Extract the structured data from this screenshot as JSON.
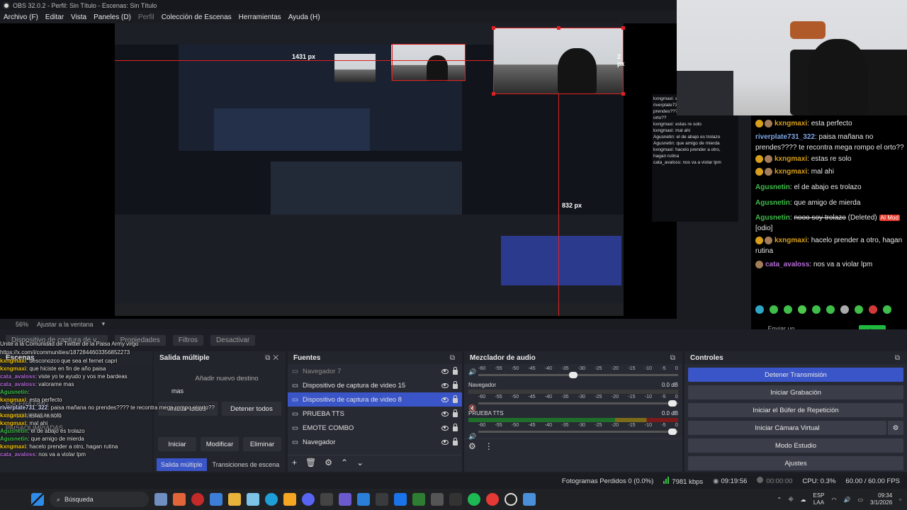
{
  "window": {
    "title": "OBS 32.0.2 - Perfil: Sin Título - Escenas: Sin Título"
  },
  "menu": [
    "Archivo (F)",
    "Editar",
    "Vista",
    "Paneles (D)",
    "Perfil",
    "Colección de Escenas",
    "Herramientas",
    "Ayuda (H)"
  ],
  "preview": {
    "px_label_1": "1431 px",
    "px_label_2": "2 px",
    "px_label_3": "832 px"
  },
  "zoom": {
    "value": "56%",
    "fit_label": "Ajustar a la ventana"
  },
  "source_toolbar": {
    "source_label": "Dispositivo de captura de v...",
    "properties": "Propiedades",
    "filters": "Filtros",
    "deactivate": "Desactivar"
  },
  "multi_output": {
    "title": "Salida múltiple",
    "add_destination": "Añadir nuevo destino",
    "name_hint": "mas",
    "start_all": "Iniciar todos",
    "stop_all": "Detener todos",
    "start": "Iniciar",
    "modify": "Modificar",
    "delete": "Eliminar",
    "tab_multi": "Salida múltiple",
    "tab_transitions": "Transiciones de escena"
  },
  "sources": {
    "title": "Fuentes",
    "items": [
      "Navegador 7",
      "Dispositivo de captura de video 15",
      "Dispositivo de captura de video 8",
      "PRUEBA TTS",
      "EMOTE COMBO",
      "Navegador"
    ]
  },
  "mixer": {
    "title": "Mezclador de audio",
    "scale": [
      "-60",
      "-55",
      "-50",
      "-45",
      "-40",
      "-35",
      "-30",
      "-25",
      "-20",
      "-15",
      "-10",
      "-5",
      "0"
    ],
    "channels": [
      {
        "name": "",
        "db": ""
      },
      {
        "name": "Navegador",
        "db": "0.0 dB"
      },
      {
        "name": "PRUEBA TTS",
        "db": "0.0 dB"
      }
    ]
  },
  "controls": {
    "title": "Controles",
    "stop_stream": "Detener Transmisión",
    "start_recording": "Iniciar Grabación",
    "replay_buffer": "Iniciar el Búfer de Repetición",
    "virtual_cam": "Iniciar Cámara Virtual",
    "studio_mode": "Modo Estudio",
    "settings": "Ajustes"
  },
  "status": {
    "dropped": "Fotogramas Perdidos 0 (0.0%)",
    "bitrate": "7981 kbps",
    "live_time": "09:19:56",
    "rec_time": "00:00:00",
    "cpu": "CPU: 0.3%",
    "fps": "60.00 / 60.00 FPS"
  },
  "taskbar": {
    "search": "Búsqueda",
    "lang": "ESP",
    "layout": "LAA",
    "time": "09:34",
    "date": "3/1/2026"
  },
  "chat": {
    "lines": [
      {
        "user": "kxngmaxi",
        "text": "esta perfecto",
        "badge": true
      },
      {
        "user": "riverplate731_322",
        "text": "paisa mañana no prendes???? te recontra mega rompo el orto??",
        "badge": false
      },
      {
        "user": "kxngmaxi",
        "text": "estas re solo",
        "badge": true
      },
      {
        "user": "kxngmaxi",
        "text": "mal ahi",
        "badge": true
      },
      {
        "user": "Agusnetin",
        "text": "el de abajo es trolazo",
        "badge": false
      },
      {
        "user": "Agusnetin",
        "text": "que amigo de mierda",
        "badge": false
      },
      {
        "user": "kxngmaxi",
        "text": "hacelo prender a otro, hagan rutina",
        "badge": true
      },
      {
        "user": "cata_avaloss",
        "text": "nos va a violar lpm",
        "badge": false
      }
    ],
    "deleted_user": "Agusnetin",
    "deleted_text": "nooo soy trolazo",
    "deleted_tag": "(Deleted)",
    "mod_tag": "AI Mod",
    "mod_note": "[odio]",
    "input_placeholder": "Enviar un mensaje",
    "chat_button": "Chat"
  },
  "overlay_chat": [
    {
      "user": "",
      "text": "Unite a la Comunidad de Twitter de la Paisa Army virgo https://x.com/i/communities/1872844603356852273"
    },
    {
      "user": "kxngmaxi",
      "text": "desconozco que sea el fernet capri"
    },
    {
      "user": "kxngmaxi",
      "text": "que hiciste en fin de año paisa"
    },
    {
      "user": "cata_avaloss",
      "text": "viste yo te ayudo y vos me bardeas"
    },
    {
      "user": "cata_avaloss",
      "text": "valorame mas"
    },
    {
      "user": "Agusnetin",
      "text": ""
    },
    {
      "user": "kxngmaxi",
      "text": "esta perfecto"
    },
    {
      "user": "riverplate731_322",
      "text": "paisa mañana no prendes???? te recontra mega rompo el orto??"
    },
    {
      "user": "kxngmaxi",
      "text": "estas re solo"
    },
    {
      "user": "kxngmaxi",
      "text": "mal ahi"
    },
    {
      "user": "Agusnetin",
      "text": "el de abajo es trolazo"
    },
    {
      "user": "Agusnetin",
      "text": "que amigo de mierda"
    },
    {
      "user": "kxngmaxi",
      "text": "hacelo prender a otro, hagan rutina"
    },
    {
      "user": "cata_avaloss",
      "text": "nos va a violar lpm"
    }
  ],
  "scenes_ghost": {
    "title": "Escenas",
    "items": [
      "ESCENA OMG",
      "YA COMENZAMOS",
      "PAISAOLIMPIADAS"
    ]
  }
}
